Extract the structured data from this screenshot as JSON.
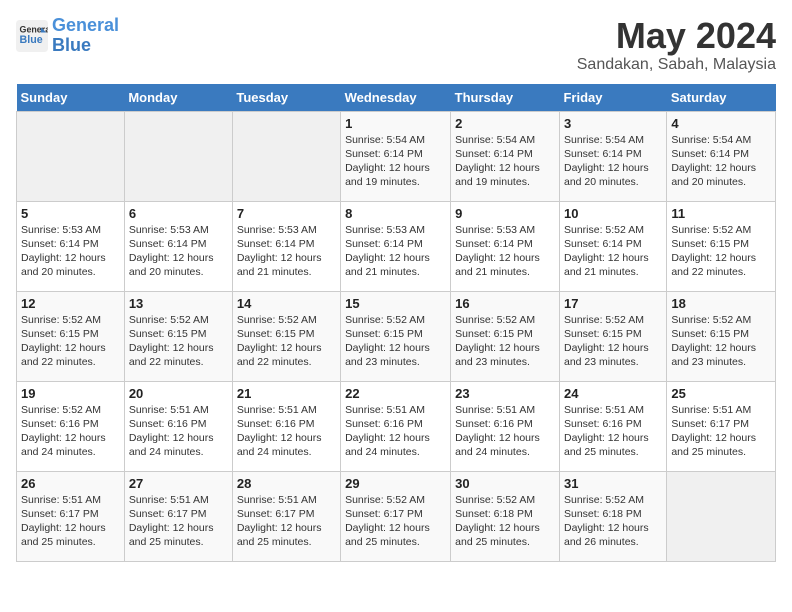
{
  "header": {
    "logo_line1": "General",
    "logo_line2": "Blue",
    "month_year": "May 2024",
    "location": "Sandakan, Sabah, Malaysia"
  },
  "days_of_week": [
    "Sunday",
    "Monday",
    "Tuesday",
    "Wednesday",
    "Thursday",
    "Friday",
    "Saturday"
  ],
  "weeks": [
    [
      {
        "day": "",
        "info": ""
      },
      {
        "day": "",
        "info": ""
      },
      {
        "day": "",
        "info": ""
      },
      {
        "day": "1",
        "info": "Sunrise: 5:54 AM\nSunset: 6:14 PM\nDaylight: 12 hours\nand 19 minutes."
      },
      {
        "day": "2",
        "info": "Sunrise: 5:54 AM\nSunset: 6:14 PM\nDaylight: 12 hours\nand 19 minutes."
      },
      {
        "day": "3",
        "info": "Sunrise: 5:54 AM\nSunset: 6:14 PM\nDaylight: 12 hours\nand 20 minutes."
      },
      {
        "day": "4",
        "info": "Sunrise: 5:54 AM\nSunset: 6:14 PM\nDaylight: 12 hours\nand 20 minutes."
      }
    ],
    [
      {
        "day": "5",
        "info": "Sunrise: 5:53 AM\nSunset: 6:14 PM\nDaylight: 12 hours\nand 20 minutes."
      },
      {
        "day": "6",
        "info": "Sunrise: 5:53 AM\nSunset: 6:14 PM\nDaylight: 12 hours\nand 20 minutes."
      },
      {
        "day": "7",
        "info": "Sunrise: 5:53 AM\nSunset: 6:14 PM\nDaylight: 12 hours\nand 21 minutes."
      },
      {
        "day": "8",
        "info": "Sunrise: 5:53 AM\nSunset: 6:14 PM\nDaylight: 12 hours\nand 21 minutes."
      },
      {
        "day": "9",
        "info": "Sunrise: 5:53 AM\nSunset: 6:14 PM\nDaylight: 12 hours\nand 21 minutes."
      },
      {
        "day": "10",
        "info": "Sunrise: 5:52 AM\nSunset: 6:14 PM\nDaylight: 12 hours\nand 21 minutes."
      },
      {
        "day": "11",
        "info": "Sunrise: 5:52 AM\nSunset: 6:15 PM\nDaylight: 12 hours\nand 22 minutes."
      }
    ],
    [
      {
        "day": "12",
        "info": "Sunrise: 5:52 AM\nSunset: 6:15 PM\nDaylight: 12 hours\nand 22 minutes."
      },
      {
        "day": "13",
        "info": "Sunrise: 5:52 AM\nSunset: 6:15 PM\nDaylight: 12 hours\nand 22 minutes."
      },
      {
        "day": "14",
        "info": "Sunrise: 5:52 AM\nSunset: 6:15 PM\nDaylight: 12 hours\nand 22 minutes."
      },
      {
        "day": "15",
        "info": "Sunrise: 5:52 AM\nSunset: 6:15 PM\nDaylight: 12 hours\nand 23 minutes."
      },
      {
        "day": "16",
        "info": "Sunrise: 5:52 AM\nSunset: 6:15 PM\nDaylight: 12 hours\nand 23 minutes."
      },
      {
        "day": "17",
        "info": "Sunrise: 5:52 AM\nSunset: 6:15 PM\nDaylight: 12 hours\nand 23 minutes."
      },
      {
        "day": "18",
        "info": "Sunrise: 5:52 AM\nSunset: 6:15 PM\nDaylight: 12 hours\nand 23 minutes."
      }
    ],
    [
      {
        "day": "19",
        "info": "Sunrise: 5:52 AM\nSunset: 6:16 PM\nDaylight: 12 hours\nand 24 minutes."
      },
      {
        "day": "20",
        "info": "Sunrise: 5:51 AM\nSunset: 6:16 PM\nDaylight: 12 hours\nand 24 minutes."
      },
      {
        "day": "21",
        "info": "Sunrise: 5:51 AM\nSunset: 6:16 PM\nDaylight: 12 hours\nand 24 minutes."
      },
      {
        "day": "22",
        "info": "Sunrise: 5:51 AM\nSunset: 6:16 PM\nDaylight: 12 hours\nand 24 minutes."
      },
      {
        "day": "23",
        "info": "Sunrise: 5:51 AM\nSunset: 6:16 PM\nDaylight: 12 hours\nand 24 minutes."
      },
      {
        "day": "24",
        "info": "Sunrise: 5:51 AM\nSunset: 6:16 PM\nDaylight: 12 hours\nand 25 minutes."
      },
      {
        "day": "25",
        "info": "Sunrise: 5:51 AM\nSunset: 6:17 PM\nDaylight: 12 hours\nand 25 minutes."
      }
    ],
    [
      {
        "day": "26",
        "info": "Sunrise: 5:51 AM\nSunset: 6:17 PM\nDaylight: 12 hours\nand 25 minutes."
      },
      {
        "day": "27",
        "info": "Sunrise: 5:51 AM\nSunset: 6:17 PM\nDaylight: 12 hours\nand 25 minutes."
      },
      {
        "day": "28",
        "info": "Sunrise: 5:51 AM\nSunset: 6:17 PM\nDaylight: 12 hours\nand 25 minutes."
      },
      {
        "day": "29",
        "info": "Sunrise: 5:52 AM\nSunset: 6:17 PM\nDaylight: 12 hours\nand 25 minutes."
      },
      {
        "day": "30",
        "info": "Sunrise: 5:52 AM\nSunset: 6:18 PM\nDaylight: 12 hours\nand 25 minutes."
      },
      {
        "day": "31",
        "info": "Sunrise: 5:52 AM\nSunset: 6:18 PM\nDaylight: 12 hours\nand 26 minutes."
      },
      {
        "day": "",
        "info": ""
      }
    ]
  ]
}
